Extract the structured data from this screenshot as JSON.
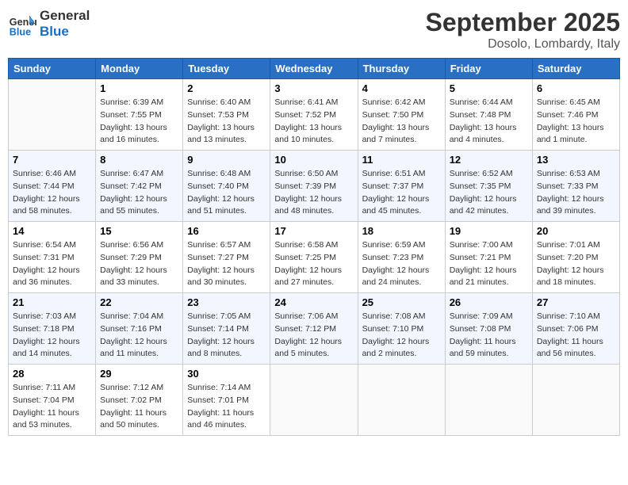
{
  "header": {
    "logo_line1": "General",
    "logo_line2": "Blue",
    "month": "September 2025",
    "location": "Dosolo, Lombardy, Italy"
  },
  "weekdays": [
    "Sunday",
    "Monday",
    "Tuesday",
    "Wednesday",
    "Thursday",
    "Friday",
    "Saturday"
  ],
  "weeks": [
    [
      {
        "day": "",
        "sunrise": "",
        "sunset": "",
        "daylight": ""
      },
      {
        "day": "1",
        "sunrise": "Sunrise: 6:39 AM",
        "sunset": "Sunset: 7:55 PM",
        "daylight": "Daylight: 13 hours and 16 minutes."
      },
      {
        "day": "2",
        "sunrise": "Sunrise: 6:40 AM",
        "sunset": "Sunset: 7:53 PM",
        "daylight": "Daylight: 13 hours and 13 minutes."
      },
      {
        "day": "3",
        "sunrise": "Sunrise: 6:41 AM",
        "sunset": "Sunset: 7:52 PM",
        "daylight": "Daylight: 13 hours and 10 minutes."
      },
      {
        "day": "4",
        "sunrise": "Sunrise: 6:42 AM",
        "sunset": "Sunset: 7:50 PM",
        "daylight": "Daylight: 13 hours and 7 minutes."
      },
      {
        "day": "5",
        "sunrise": "Sunrise: 6:44 AM",
        "sunset": "Sunset: 7:48 PM",
        "daylight": "Daylight: 13 hours and 4 minutes."
      },
      {
        "day": "6",
        "sunrise": "Sunrise: 6:45 AM",
        "sunset": "Sunset: 7:46 PM",
        "daylight": "Daylight: 13 hours and 1 minute."
      }
    ],
    [
      {
        "day": "7",
        "sunrise": "Sunrise: 6:46 AM",
        "sunset": "Sunset: 7:44 PM",
        "daylight": "Daylight: 12 hours and 58 minutes."
      },
      {
        "day": "8",
        "sunrise": "Sunrise: 6:47 AM",
        "sunset": "Sunset: 7:42 PM",
        "daylight": "Daylight: 12 hours and 55 minutes."
      },
      {
        "day": "9",
        "sunrise": "Sunrise: 6:48 AM",
        "sunset": "Sunset: 7:40 PM",
        "daylight": "Daylight: 12 hours and 51 minutes."
      },
      {
        "day": "10",
        "sunrise": "Sunrise: 6:50 AM",
        "sunset": "Sunset: 7:39 PM",
        "daylight": "Daylight: 12 hours and 48 minutes."
      },
      {
        "day": "11",
        "sunrise": "Sunrise: 6:51 AM",
        "sunset": "Sunset: 7:37 PM",
        "daylight": "Daylight: 12 hours and 45 minutes."
      },
      {
        "day": "12",
        "sunrise": "Sunrise: 6:52 AM",
        "sunset": "Sunset: 7:35 PM",
        "daylight": "Daylight: 12 hours and 42 minutes."
      },
      {
        "day": "13",
        "sunrise": "Sunrise: 6:53 AM",
        "sunset": "Sunset: 7:33 PM",
        "daylight": "Daylight: 12 hours and 39 minutes."
      }
    ],
    [
      {
        "day": "14",
        "sunrise": "Sunrise: 6:54 AM",
        "sunset": "Sunset: 7:31 PM",
        "daylight": "Daylight: 12 hours and 36 minutes."
      },
      {
        "day": "15",
        "sunrise": "Sunrise: 6:56 AM",
        "sunset": "Sunset: 7:29 PM",
        "daylight": "Daylight: 12 hours and 33 minutes."
      },
      {
        "day": "16",
        "sunrise": "Sunrise: 6:57 AM",
        "sunset": "Sunset: 7:27 PM",
        "daylight": "Daylight: 12 hours and 30 minutes."
      },
      {
        "day": "17",
        "sunrise": "Sunrise: 6:58 AM",
        "sunset": "Sunset: 7:25 PM",
        "daylight": "Daylight: 12 hours and 27 minutes."
      },
      {
        "day": "18",
        "sunrise": "Sunrise: 6:59 AM",
        "sunset": "Sunset: 7:23 PM",
        "daylight": "Daylight: 12 hours and 24 minutes."
      },
      {
        "day": "19",
        "sunrise": "Sunrise: 7:00 AM",
        "sunset": "Sunset: 7:21 PM",
        "daylight": "Daylight: 12 hours and 21 minutes."
      },
      {
        "day": "20",
        "sunrise": "Sunrise: 7:01 AM",
        "sunset": "Sunset: 7:20 PM",
        "daylight": "Daylight: 12 hours and 18 minutes."
      }
    ],
    [
      {
        "day": "21",
        "sunrise": "Sunrise: 7:03 AM",
        "sunset": "Sunset: 7:18 PM",
        "daylight": "Daylight: 12 hours and 14 minutes."
      },
      {
        "day": "22",
        "sunrise": "Sunrise: 7:04 AM",
        "sunset": "Sunset: 7:16 PM",
        "daylight": "Daylight: 12 hours and 11 minutes."
      },
      {
        "day": "23",
        "sunrise": "Sunrise: 7:05 AM",
        "sunset": "Sunset: 7:14 PM",
        "daylight": "Daylight: 12 hours and 8 minutes."
      },
      {
        "day": "24",
        "sunrise": "Sunrise: 7:06 AM",
        "sunset": "Sunset: 7:12 PM",
        "daylight": "Daylight: 12 hours and 5 minutes."
      },
      {
        "day": "25",
        "sunrise": "Sunrise: 7:08 AM",
        "sunset": "Sunset: 7:10 PM",
        "daylight": "Daylight: 12 hours and 2 minutes."
      },
      {
        "day": "26",
        "sunrise": "Sunrise: 7:09 AM",
        "sunset": "Sunset: 7:08 PM",
        "daylight": "Daylight: 11 hours and 59 minutes."
      },
      {
        "day": "27",
        "sunrise": "Sunrise: 7:10 AM",
        "sunset": "Sunset: 7:06 PM",
        "daylight": "Daylight: 11 hours and 56 minutes."
      }
    ],
    [
      {
        "day": "28",
        "sunrise": "Sunrise: 7:11 AM",
        "sunset": "Sunset: 7:04 PM",
        "daylight": "Daylight: 11 hours and 53 minutes."
      },
      {
        "day": "29",
        "sunrise": "Sunrise: 7:12 AM",
        "sunset": "Sunset: 7:02 PM",
        "daylight": "Daylight: 11 hours and 50 minutes."
      },
      {
        "day": "30",
        "sunrise": "Sunrise: 7:14 AM",
        "sunset": "Sunset: 7:01 PM",
        "daylight": "Daylight: 11 hours and 46 minutes."
      },
      {
        "day": "",
        "sunrise": "",
        "sunset": "",
        "daylight": ""
      },
      {
        "day": "",
        "sunrise": "",
        "sunset": "",
        "daylight": ""
      },
      {
        "day": "",
        "sunrise": "",
        "sunset": "",
        "daylight": ""
      },
      {
        "day": "",
        "sunrise": "",
        "sunset": "",
        "daylight": ""
      }
    ]
  ]
}
